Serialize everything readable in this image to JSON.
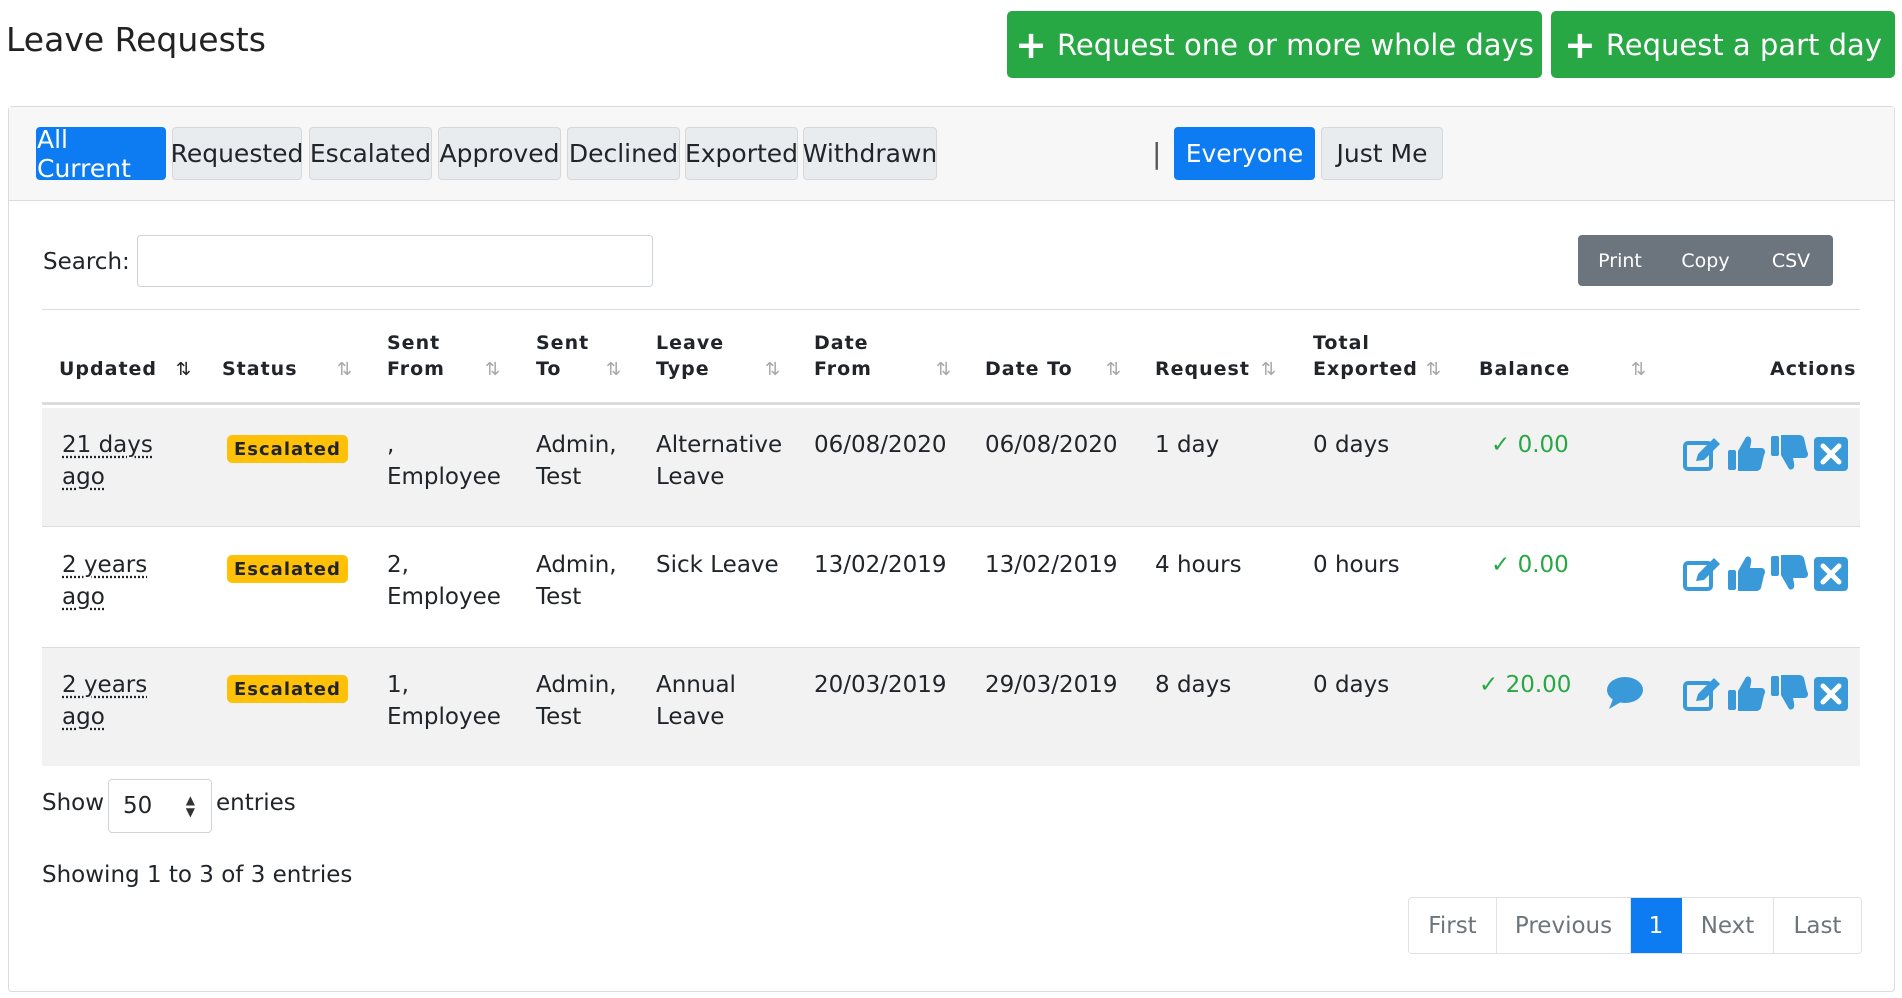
{
  "header": {
    "title": "Leave Requests",
    "btn_whole_days": "Request one or more whole days",
    "btn_part_day": "Request a part day",
    "plus_glyph": "+"
  },
  "tabs": [
    {
      "label": "All Current",
      "active": true
    },
    {
      "label": "Requested",
      "active": false
    },
    {
      "label": "Escalated",
      "active": false
    },
    {
      "label": "Approved",
      "active": false
    },
    {
      "label": "Declined",
      "active": false
    },
    {
      "label": "Exported",
      "active": false
    },
    {
      "label": "Withdrawn",
      "active": false
    }
  ],
  "tab_separator": "|",
  "scope_tabs": [
    {
      "label": "Everyone",
      "active": true
    },
    {
      "label": "Just Me",
      "active": false
    }
  ],
  "search": {
    "label": "Search:",
    "value": "",
    "placeholder": ""
  },
  "export_buttons": {
    "print": "Print",
    "copy": "Copy",
    "csv": "CSV"
  },
  "columns": {
    "updated": "Updated",
    "status": "Status",
    "sent_from": "Sent From",
    "sent_to": "Sent To",
    "leave_type": "Leave Type",
    "date_from": "Date From",
    "date_to": "Date To",
    "request": "Request",
    "total_exported": "Total Exported",
    "balance": "Balance",
    "actions": "Actions"
  },
  "rows": [
    {
      "updated": "21 days ago",
      "status": "Escalated",
      "sent_from": ", Employee",
      "sent_to": "Admin, Test",
      "leave_type": "Alternative Leave",
      "date_from": "06/08/2020",
      "date_to": "06/08/2020",
      "request": "1 day",
      "total_exported": "0 days",
      "balance": "0.00",
      "has_comment": false
    },
    {
      "updated": "2 years ago",
      "status": "Escalated",
      "sent_from": "2, Employee",
      "sent_to": "Admin, Test",
      "leave_type": "Sick Leave",
      "date_from": "13/02/2019",
      "date_to": "13/02/2019",
      "request": "4 hours",
      "total_exported": "0 hours",
      "balance": "0.00",
      "has_comment": false
    },
    {
      "updated": "2 years ago",
      "status": "Escalated",
      "sent_from": "1, Employee",
      "sent_to": "Admin, Test",
      "leave_type": "Annual Leave",
      "date_from": "20/03/2019",
      "date_to": "29/03/2019",
      "request": "8 days",
      "total_exported": "0 days",
      "balance": "20.00",
      "has_comment": true
    }
  ],
  "footer": {
    "show_label": "Show",
    "page_length": "50",
    "entries_label": "entries",
    "info": "Showing 1 to 3 of 3 entries"
  },
  "pagination": {
    "first": "First",
    "previous": "Previous",
    "current": "1",
    "next": "Next",
    "last": "Last"
  },
  "colors": {
    "primary": "#0d7cf2",
    "success": "#28a745",
    "warning": "#ffc107",
    "icon_blue": "#3a9ad9",
    "secondary": "#6c757d"
  },
  "icons": {
    "sort": "sort-arrows-icon",
    "check": "check-icon",
    "edit": "edit-icon",
    "approve": "thumbs-up-icon",
    "decline": "thumbs-down-icon",
    "cancel": "close-box-icon",
    "comment": "comment-icon"
  }
}
